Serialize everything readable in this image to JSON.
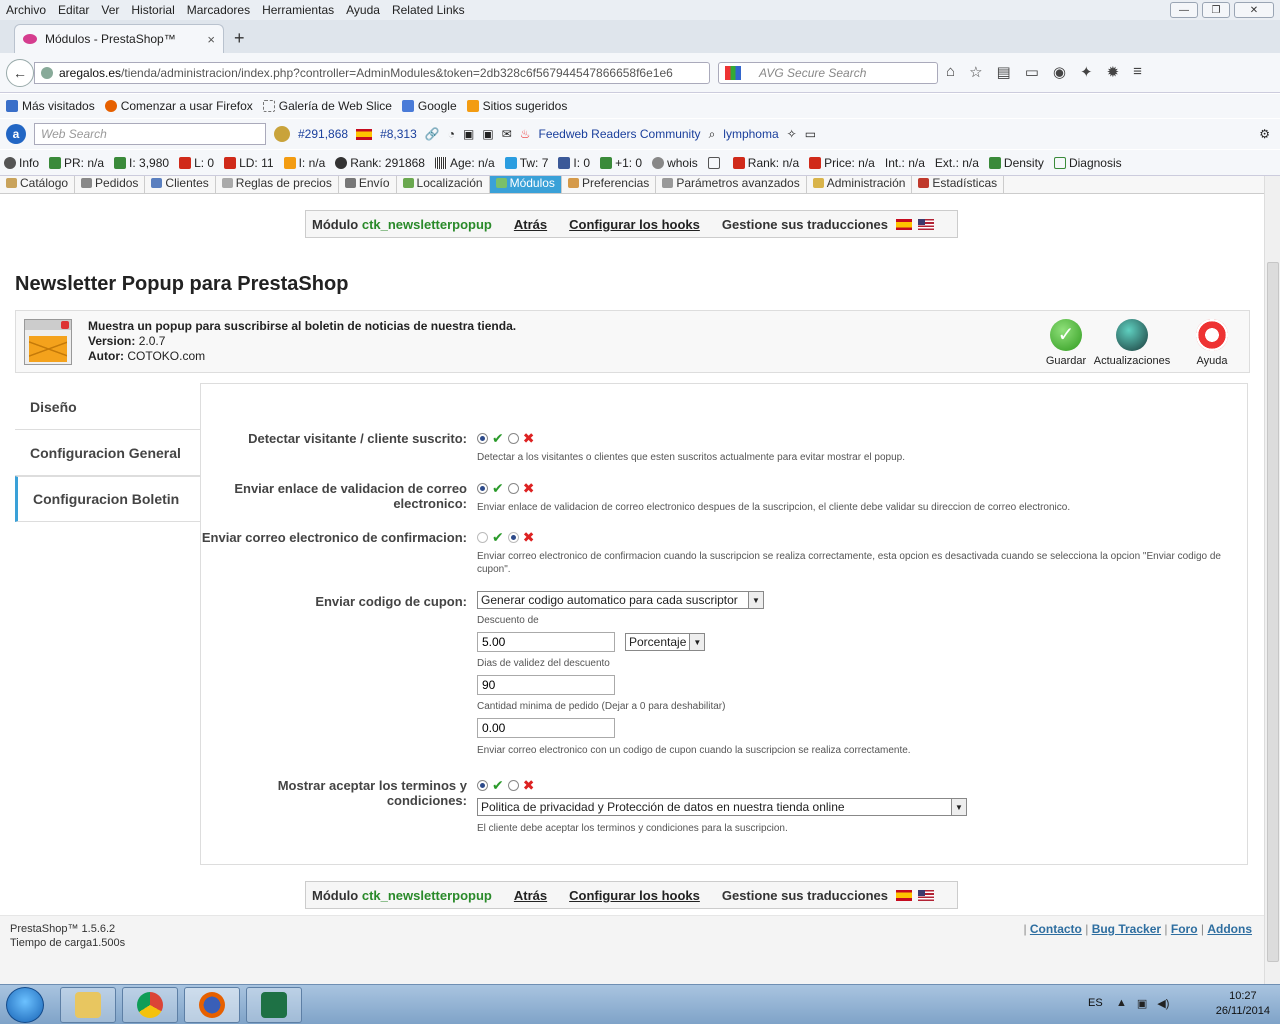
{
  "browser": {
    "menu": [
      "Archivo",
      "Editar",
      "Ver",
      "Historial",
      "Marcadores",
      "Herramientas",
      "Ayuda",
      "Related Links"
    ],
    "tab_title": "Módulos - PrestaShop™",
    "url_host": "aregalos.es",
    "url_path": "/tienda/administracion/index.php?controller=AdminModules&token=2db328c6f567944547866658f6e1e6",
    "search_placeholder": "AVG Secure Search",
    "bookmarks": [
      "Más visitados",
      "Comenzar a usar Firefox",
      "Galería de Web Slice",
      "Google",
      "Sitios sugeridos"
    ],
    "toolbar3": {
      "web_search_placeholder": "Web Search",
      "rank1": "#291,868",
      "rank2": "#8,313",
      "feedweb": "Feedweb Readers Community",
      "lymphoma": "lymphoma"
    },
    "seo": [
      "Info",
      "PR: n/a",
      "I: 3,980",
      "L: 0",
      "LD: 11",
      "I: n/a",
      "Rank: 291868",
      "Age: n/a",
      "Tw: 7",
      "I: 0",
      "+1: 0",
      "whois",
      "Rank: n/a",
      "Price: n/a",
      "Int.: n/a",
      "Ext.: n/a",
      "Density",
      "Diagnosis"
    ]
  },
  "admin_tabs": [
    "Catálogo",
    "Pedidos",
    "Clientes",
    "Reglas de precios",
    "Envío",
    "Localización",
    "Módulos",
    "Preferencias",
    "Parámetros avanzados",
    "Administración",
    "Estadísticas"
  ],
  "modbar": {
    "module_prefix": "Módulo",
    "module_name": "ctk_newsletterpopup",
    "back": "Atrás",
    "hooks": "Configurar los hooks",
    "translations": "Gestione sus traducciones"
  },
  "page_title": "Newsletter Popup para PrestaShop",
  "info": {
    "description": "Muestra un popup para suscribirse al boletin de noticias de nuestra tienda.",
    "version_label": "Version:",
    "version": "2.0.7",
    "author_label": "Autor:",
    "author": "COTOKO.com",
    "actions": [
      "Guardar",
      "Actualizaciones",
      "Ayuda"
    ]
  },
  "side_tabs": [
    "Diseño",
    "Configuracion General",
    "Configuracion Boletin"
  ],
  "form": {
    "detect": {
      "label": "Detectar visitante / cliente suscrito:",
      "help": "Detectar a los visitantes o clientes que esten suscritos actualmente para evitar mostrar el popup."
    },
    "validation": {
      "label": "Enviar enlace de validacion de correo electronico:",
      "help": "Enviar enlace de validacion de correo electronico despues de la suscripcion, el cliente debe validar su direccion de correo electronico."
    },
    "confirmation": {
      "label": "Enviar correo electronico de confirmacion:",
      "help": "Enviar correo electronico de confirmacion cuando la suscripcion se realiza correctamente, esta opcion es desactivada cuando se selecciona la opcion \"Enviar codigo de cupon\"."
    },
    "coupon": {
      "label": "Enviar codigo de cupon:",
      "select_value": "Generar codigo automatico para cada suscriptor",
      "discount_label": "Descuento de",
      "discount_value": "5.00",
      "discount_type": "Porcentaje",
      "validity_label": "Dias de validez del descuento",
      "validity_value": "90",
      "min_order_label": "Cantidad minima de pedido (Dejar a 0 para deshabilitar)",
      "min_order_value": "0.00",
      "help": "Enviar correo electronico con un codigo de cupon cuando la suscripcion se realiza correctamente."
    },
    "terms": {
      "label": "Mostrar aceptar los terminos y condiciones:",
      "select_value": "Politica de privacidad y Protección de datos en nuestra tienda online",
      "help": "El cliente debe aceptar los terminos y condiciones para la suscripcion."
    }
  },
  "footer": {
    "version": "PrestaShop™ 1.5.6.2",
    "load_time": "Tiempo de carga1.500s",
    "links": [
      "Contacto",
      "Bug Tracker",
      "Foro",
      "Addons"
    ]
  },
  "taskbar": {
    "lang": "ES",
    "time": "10:27",
    "date": "26/11/2014"
  }
}
